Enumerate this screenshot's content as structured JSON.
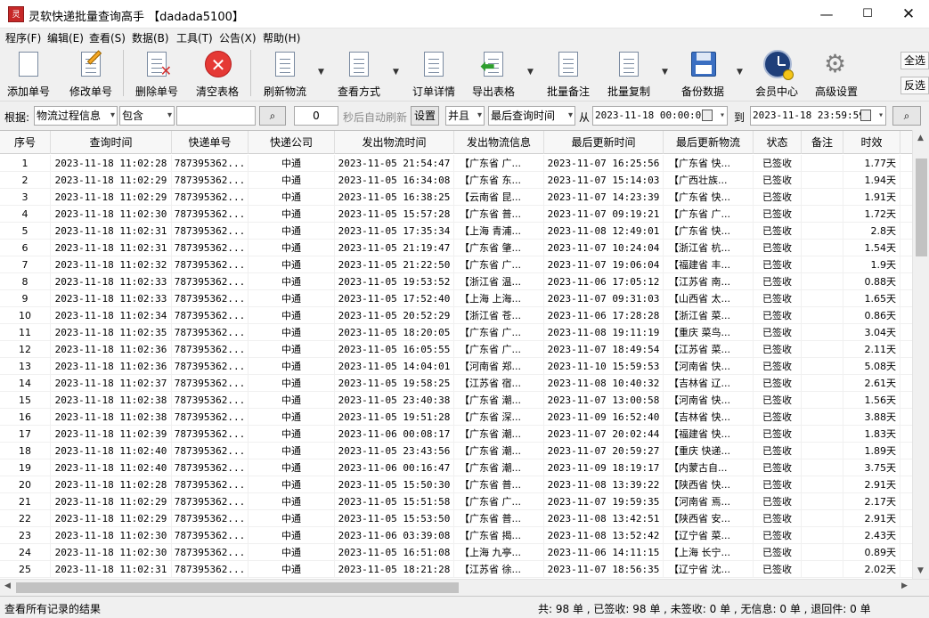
{
  "window": {
    "app_icon_text": "灵软",
    "title": "灵软快递批量查询高手 【dadada5100】",
    "minimize": "—",
    "maximize": "☐",
    "close": "✕"
  },
  "menu": [
    "程序(F)",
    "编辑(E)",
    "查看(S)",
    "数据(B)",
    "工具(T)",
    "公告(X)",
    "帮助(H)"
  ],
  "toolbar": {
    "add": "添加单号",
    "edit": "修改单号",
    "delete": "删除单号",
    "clear": "清空表格",
    "refresh": "刷新物流",
    "view_mode": "查看方式",
    "order_detail": "订单详情",
    "export": "导出表格",
    "batch_note": "批量备注",
    "batch_copy": "批量复制",
    "backup": "备份数据",
    "member": "会员中心",
    "advanced": "高级设置",
    "select_all": "全选",
    "invert": "反选"
  },
  "filter": {
    "by_label": "根据:",
    "field": "物流过程信息",
    "match": "包含",
    "keyword": "",
    "refresh_seconds": "0",
    "auto_refresh_label": "秒后自动刷新",
    "settings": "设置",
    "logic": "并且",
    "time_field": "最后查询时间",
    "from_label": "从",
    "from": "2023-11-18 00:00:00",
    "to_label": "到",
    "to": "2023-11-18 23:59:59",
    "search_icon_glyph": "⌕",
    "caret": "▾"
  },
  "columns": [
    "序号",
    "查询时间",
    "快递单号",
    "快递公司",
    "发出物流时间",
    "发出物流信息",
    "最后更新时间",
    "最后更新物流",
    "状态",
    "备注",
    "时效"
  ],
  "rows": [
    [
      "1",
      "2023-11-18 11:02:28",
      "787395362...",
      "中通",
      "2023-11-05 21:54:47",
      "【广东省 广...",
      "2023-11-07 16:25:56",
      "【广东省 快...",
      "已签收",
      "",
      "1.77天"
    ],
    [
      "2",
      "2023-11-18 11:02:29",
      "787395362...",
      "中通",
      "2023-11-05 16:34:08",
      "【广东省 东...",
      "2023-11-07 15:14:03",
      "【广西壮族...",
      "已签收",
      "",
      "1.94天"
    ],
    [
      "3",
      "2023-11-18 11:02:29",
      "787395362...",
      "中通",
      "2023-11-05 16:38:25",
      "【云南省 昆...",
      "2023-11-07 14:23:39",
      "【广东省 快...",
      "已签收",
      "",
      "1.91天"
    ],
    [
      "4",
      "2023-11-18 11:02:30",
      "787395362...",
      "中通",
      "2023-11-05 15:57:28",
      "【广东省 普...",
      "2023-11-07 09:19:21",
      "【广东省 广...",
      "已签收",
      "",
      "1.72天"
    ],
    [
      "5",
      "2023-11-18 11:02:31",
      "787395362...",
      "中通",
      "2023-11-05 17:35:34",
      "【上海 青浦...",
      "2023-11-08 12:49:01",
      "【广东省 快...",
      "已签收",
      "",
      "2.8天"
    ],
    [
      "6",
      "2023-11-18 11:02:31",
      "787395362...",
      "中通",
      "2023-11-05 21:19:47",
      "【广东省 肇...",
      "2023-11-07 10:24:04",
      "【浙江省 杭...",
      "已签收",
      "",
      "1.54天"
    ],
    [
      "7",
      "2023-11-18 11:02:32",
      "787395362...",
      "中通",
      "2023-11-05 21:22:50",
      "【广东省 广...",
      "2023-11-07 19:06:04",
      "【福建省 丰...",
      "已签收",
      "",
      "1.9天"
    ],
    [
      "8",
      "2023-11-18 11:02:33",
      "787395362...",
      "中通",
      "2023-11-05 19:53:52",
      "【浙江省 温...",
      "2023-11-06 17:05:12",
      "【江苏省 南...",
      "已签收",
      "",
      "0.88天"
    ],
    [
      "9",
      "2023-11-18 11:02:33",
      "787395362...",
      "中通",
      "2023-11-05 17:52:40",
      "【上海 上海...",
      "2023-11-07 09:31:03",
      "【山西省 太...",
      "已签收",
      "",
      "1.65天"
    ],
    [
      "10",
      "2023-11-18 11:02:34",
      "787395362...",
      "中通",
      "2023-11-05 20:52:29",
      "【浙江省 苍...",
      "2023-11-06 17:28:28",
      "【浙江省 菜...",
      "已签收",
      "",
      "0.86天"
    ],
    [
      "11",
      "2023-11-18 11:02:35",
      "787395362...",
      "中通",
      "2023-11-05 18:20:05",
      "【广东省 广...",
      "2023-11-08 19:11:19",
      "【重庆 菜鸟...",
      "已签收",
      "",
      "3.04天"
    ],
    [
      "12",
      "2023-11-18 11:02:36",
      "787395362...",
      "中通",
      "2023-11-05 16:05:55",
      "【广东省 广...",
      "2023-11-07 18:49:54",
      "【江苏省 菜...",
      "已签收",
      "",
      "2.11天"
    ],
    [
      "13",
      "2023-11-18 11:02:36",
      "787395362...",
      "中通",
      "2023-11-05 14:04:01",
      "【河南省 郑...",
      "2023-11-10 15:59:53",
      "【河南省 快...",
      "已签收",
      "",
      "5.08天"
    ],
    [
      "14",
      "2023-11-18 11:02:37",
      "787395362...",
      "中通",
      "2023-11-05 19:58:25",
      "【江苏省 宿...",
      "2023-11-08 10:40:32",
      "【吉林省 辽...",
      "已签收",
      "",
      "2.61天"
    ],
    [
      "15",
      "2023-11-18 11:02:38",
      "787395362...",
      "中通",
      "2023-11-05 23:40:38",
      "【广东省 潮...",
      "2023-11-07 13:00:58",
      "【河南省 快...",
      "已签收",
      "",
      "1.56天"
    ],
    [
      "16",
      "2023-11-18 11:02:38",
      "787395362...",
      "中通",
      "2023-11-05 19:51:28",
      "【广东省 深...",
      "2023-11-09 16:52:40",
      "【吉林省 快...",
      "已签收",
      "",
      "3.88天"
    ],
    [
      "17",
      "2023-11-18 11:02:39",
      "787395362...",
      "中通",
      "2023-11-06 00:08:17",
      "【广东省 潮...",
      "2023-11-07 20:02:44",
      "【福建省 快...",
      "已签收",
      "",
      "1.83天"
    ],
    [
      "18",
      "2023-11-18 11:02:40",
      "787395362...",
      "中通",
      "2023-11-05 23:43:56",
      "【广东省 潮...",
      "2023-11-07 20:59:27",
      "【重庆 快递...",
      "已签收",
      "",
      "1.89天"
    ],
    [
      "19",
      "2023-11-18 11:02:40",
      "787395362...",
      "中通",
      "2023-11-06 00:16:47",
      "【广东省 潮...",
      "2023-11-09 18:19:17",
      "【内蒙古自...",
      "已签收",
      "",
      "3.75天"
    ],
    [
      "20",
      "2023-11-18 11:02:28",
      "787395362...",
      "中通",
      "2023-11-05 15:50:30",
      "【广东省 普...",
      "2023-11-08 13:39:22",
      "【陕西省 快...",
      "已签收",
      "",
      "2.91天"
    ],
    [
      "21",
      "2023-11-18 11:02:29",
      "787395362...",
      "中通",
      "2023-11-05 15:51:58",
      "【广东省 广...",
      "2023-11-07 19:59:35",
      "【河南省 焉...",
      "已签收",
      "",
      "2.17天"
    ],
    [
      "22",
      "2023-11-18 11:02:29",
      "787395362...",
      "中通",
      "2023-11-05 15:53:50",
      "【广东省 普...",
      "2023-11-08 13:42:51",
      "【陕西省 安...",
      "已签收",
      "",
      "2.91天"
    ],
    [
      "23",
      "2023-11-18 11:02:30",
      "787395362...",
      "中通",
      "2023-11-06 03:39:08",
      "【广东省 揭...",
      "2023-11-08 13:52:42",
      "【辽宁省 菜...",
      "已签收",
      "",
      "2.43天"
    ],
    [
      "24",
      "2023-11-18 11:02:30",
      "787395362...",
      "中通",
      "2023-11-05 16:51:08",
      "【上海 九亭...",
      "2023-11-06 14:11:15",
      "【上海 长宁...",
      "已签收",
      "",
      "0.89天"
    ],
    [
      "25",
      "2023-11-18 11:02:31",
      "787395362...",
      "中通",
      "2023-11-05 18:21:28",
      "【江苏省 徐...",
      "2023-11-07 18:56:35",
      "【辽宁省 沈...",
      "已签收",
      "",
      "2.02天"
    ]
  ],
  "status": {
    "left": "查看所有记录的结果",
    "summary": "共: 98 单 , 已签收:  98 单 , 未签收:  0 单 , 无信息: 0 单 , 退回件:  0 单"
  }
}
